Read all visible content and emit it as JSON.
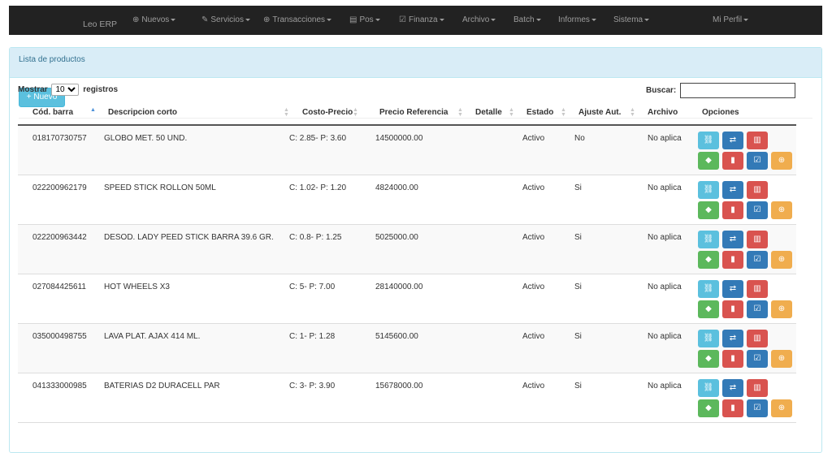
{
  "navbar": {
    "brand": "Leo ERP",
    "items": [
      {
        "label": "Nuevos",
        "icon": "plus-circle-icon",
        "glyph": "⊕"
      },
      {
        "label": "Servicios",
        "icon": "wrench-icon",
        "glyph": "✎"
      },
      {
        "label": "Transacciones",
        "icon": "plus-circle-icon",
        "glyph": "⊕"
      },
      {
        "label": "Pos",
        "icon": "cart-icon",
        "glyph": "▤"
      },
      {
        "label": "Finanza",
        "icon": "edit-icon",
        "glyph": "☑"
      },
      {
        "label": "Archivo",
        "icon": "",
        "glyph": ""
      },
      {
        "label": "Batch",
        "icon": "",
        "glyph": ""
      },
      {
        "label": "Informes",
        "icon": "",
        "glyph": ""
      },
      {
        "label": "Sistema",
        "icon": "",
        "glyph": ""
      },
      {
        "label": "Mi Perfil",
        "icon": "",
        "glyph": ""
      }
    ]
  },
  "panel": {
    "heading": "Lista de productos"
  },
  "toolbar": {
    "new_label": "+ Nuevo"
  },
  "table_controls": {
    "show_label": "Mostrar",
    "page_size": "10",
    "records_label": "registros",
    "search_label": "Buscar:",
    "search_value": ""
  },
  "table": {
    "columns": [
      "Cód. barra",
      "Descripcion corto",
      "Costo-Precio",
      "Precio Referencia",
      "Detalle",
      "Estado",
      "Ajuste Aut.",
      "Archivo",
      "Opciones"
    ],
    "rows": [
      {
        "barcode": "018170730757",
        "desc": "GLOBO MET. 50 UND.",
        "cost": "C: 2.85- P: 3.60",
        "ref": "14500000.00",
        "detalle": "",
        "estado": "Activo",
        "ajuste": "No",
        "archivo": "No aplica"
      },
      {
        "barcode": "022200962179",
        "desc": "SPEED STICK ROLLON 50ML",
        "cost": "C: 1.02- P: 1.20",
        "ref": "4824000.00",
        "detalle": "",
        "estado": "Activo",
        "ajuste": "Si",
        "archivo": "No aplica"
      },
      {
        "barcode": "022200963442",
        "desc": "DESOD. LADY PEED STICK BARRA 39.6 GR.",
        "cost": "C: 0.8- P: 1.25",
        "ref": "5025000.00",
        "detalle": "",
        "estado": "Activo",
        "ajuste": "Si",
        "archivo": "No aplica"
      },
      {
        "barcode": "027084425611",
        "desc": "HOT WHEELS X3",
        "cost": "C: 5- P: 7.00",
        "ref": "28140000.00",
        "detalle": "",
        "estado": "Activo",
        "ajuste": "Si",
        "archivo": "No aplica"
      },
      {
        "barcode": "035000498755",
        "desc": "LAVA PLAT. AJAX 414 ML.",
        "cost": "C: 1- P: 1.28",
        "ref": "5145600.00",
        "detalle": "",
        "estado": "Activo",
        "ajuste": "Si",
        "archivo": "No aplica"
      },
      {
        "barcode": "041333000985",
        "desc": "BATERIAS D2 DURACELL PAR",
        "cost": "C: 3- P: 3.90",
        "ref": "15678000.00",
        "detalle": "",
        "estado": "Activo",
        "ajuste": "Si",
        "archivo": "No aplica"
      }
    ]
  },
  "option_buttons": [
    {
      "name": "link-icon",
      "glyph": "⛓",
      "class": "b-info"
    },
    {
      "name": "refresh-icon",
      "glyph": "⇄",
      "class": "b-primary"
    },
    {
      "name": "chart-icon",
      "glyph": "▥",
      "class": "b-danger"
    },
    {
      "name": "tag-icon",
      "glyph": "◆",
      "class": "b-success"
    },
    {
      "name": "trash-icon",
      "glyph": "▮",
      "class": "b-danger"
    },
    {
      "name": "edit-icon",
      "glyph": "☑",
      "class": "b-primary"
    },
    {
      "name": "zoom-icon",
      "glyph": "⊕",
      "class": "b-warning"
    }
  ]
}
